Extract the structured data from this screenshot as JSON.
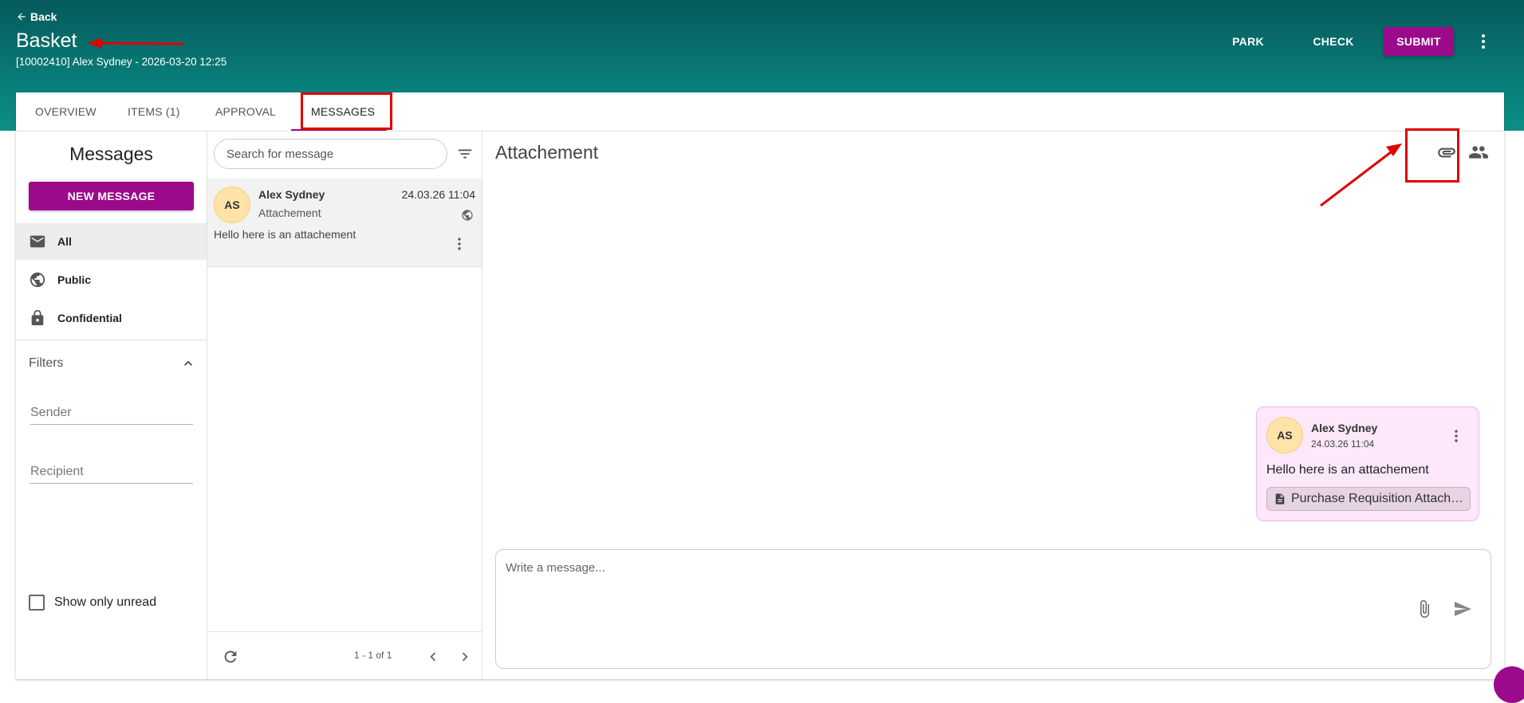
{
  "header": {
    "back_label": "Back",
    "title": "Basket",
    "subtitle": "[10002410] Alex Sydney - 2026-03-20 12:25",
    "actions": {
      "park": "PARK",
      "check": "CHECK",
      "submit": "SUBMIT"
    }
  },
  "tabs": [
    {
      "label": "OVERVIEW"
    },
    {
      "label": "ITEMS (1)"
    },
    {
      "label": "APPROVAL"
    },
    {
      "label": "MESSAGES",
      "active": true
    }
  ],
  "sidebar": {
    "heading": "Messages",
    "new_message": "NEW MESSAGE",
    "nav": [
      {
        "label": "All",
        "icon": "mail-icon",
        "selected": true
      },
      {
        "label": "Public",
        "icon": "globe-icon"
      },
      {
        "label": "Confidential",
        "icon": "lock-icon"
      }
    ],
    "filters": {
      "heading": "Filters",
      "sender_label": "Sender",
      "recipient_label": "Recipient",
      "unread_label": "Show only unread",
      "unread_checked": false
    }
  },
  "list": {
    "search_placeholder": "Search for message",
    "items": [
      {
        "initials": "AS",
        "sender": "Alex Sydney",
        "subject": "Attachement",
        "date": "24.03.26 11:04",
        "preview": "Hello here is an attachement",
        "visibility_icon": "globe-icon"
      }
    ],
    "pagination": "1 - 1 of 1"
  },
  "thread": {
    "title": "Attachement",
    "message": {
      "initials": "AS",
      "sender": "Alex Sydney",
      "date": "24.03.26 11:04",
      "text": "Hello here is an attachement",
      "attachment": "Purchase Requisition Attach…"
    },
    "composer_placeholder": "Write a message..."
  },
  "colors": {
    "header_teal": "#06595a",
    "brand_magenta": "#9b0a8a",
    "annotation_red": "#e00000",
    "bubble_bg": "#fce7fb",
    "avatar_bg": "#fde3a7"
  }
}
